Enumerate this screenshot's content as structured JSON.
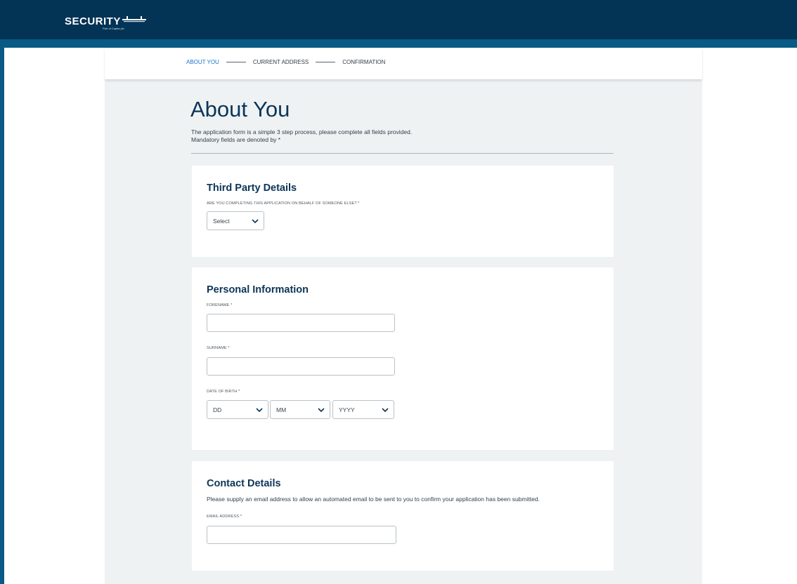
{
  "header": {
    "logo_text": "SECURITY",
    "logo_tagline": "Part of Capita plc"
  },
  "stepper": {
    "steps": [
      {
        "label": "ABOUT YOU",
        "active": true
      },
      {
        "label": "CURRENT ADDRESS",
        "active": false
      },
      {
        "label": "CONFIRMATION",
        "active": false
      }
    ]
  },
  "page": {
    "title": "About You",
    "intro_line1": "The application form is a simple 3 step process, please complete all fields provided.",
    "intro_line2": "Mandatory fields are denoted by *"
  },
  "third_party": {
    "title": "Third Party Details",
    "question_label": "ARE YOU COMPLETING THIS APPLICATION ON BEHALF OF SOMEONE ELSE? *",
    "select_value": "Select"
  },
  "personal": {
    "title": "Personal Information",
    "forename_label": "FORENAME *",
    "forename_value": "",
    "surname_label": "SURNAME *",
    "surname_value": "",
    "dob_label": "DATE OF BIRTH *",
    "dob_day": "DD",
    "dob_month": "MM",
    "dob_year": "YYYY"
  },
  "contact": {
    "title": "Contact Details",
    "description": "Please supply an email address to allow an automated email to be sent to you to confirm your application has been submitted.",
    "email_label": "EMAIL ADDRESS *",
    "email_value": ""
  },
  "colors": {
    "header_bg": "#033456",
    "header_stripe": "#0a5a86",
    "content_bg": "#eef2f3",
    "title_color": "#0c3558",
    "active_step": "#1d72c9"
  },
  "icons": {
    "select_chevron": "chevron-down-icon",
    "logo_mark": "logo-mark-icon"
  }
}
